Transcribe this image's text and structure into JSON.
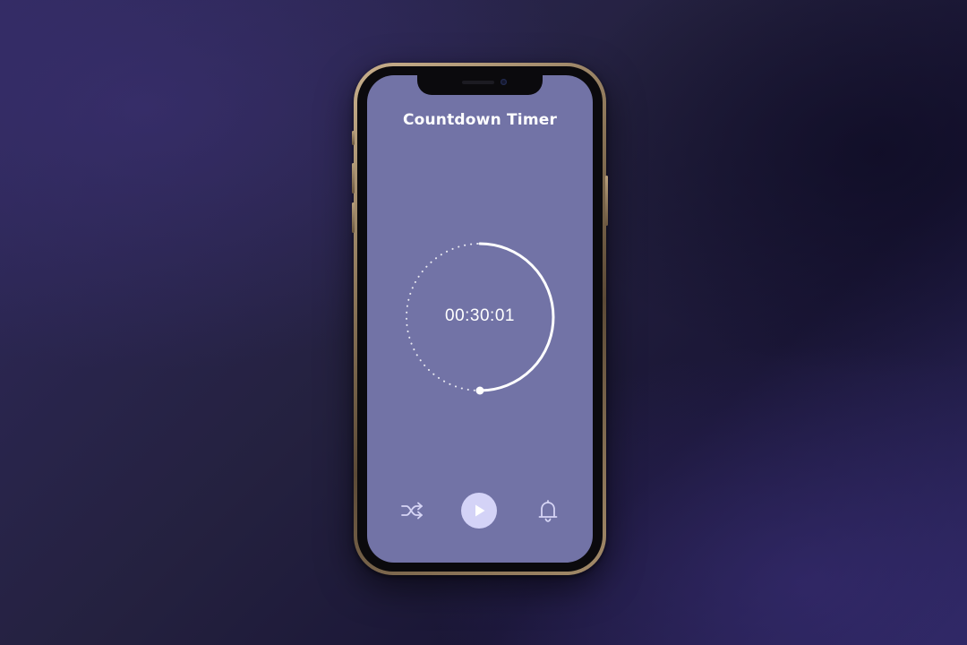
{
  "app": {
    "title": "Countdown Timer"
  },
  "timer": {
    "display": "00:30:01",
    "progress": 0.5
  },
  "controls": {
    "shuffle_icon": "shuffle-icon",
    "play_icon": "play-icon",
    "bell_icon": "bell-icon"
  },
  "colors": {
    "screen_bg": "#7273a6",
    "ring": "#ffffff",
    "play_button_bg": "#d4d3f7",
    "play_triangle": "#ffffff",
    "icon": "#d6d5f5"
  }
}
